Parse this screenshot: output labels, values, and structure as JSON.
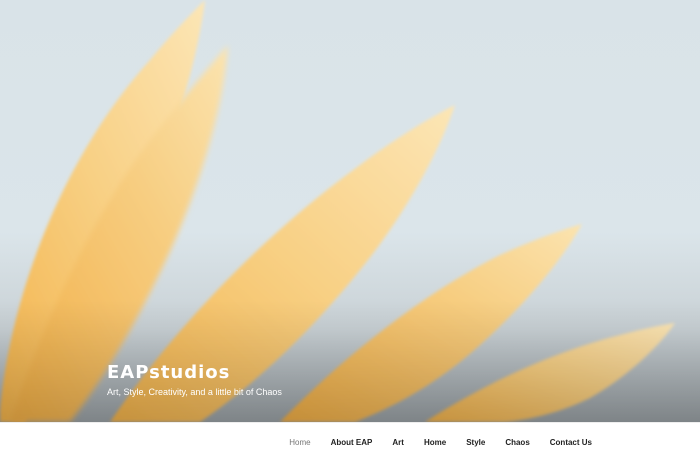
{
  "header": {
    "site_title": "EAPstudios",
    "site_description": "Art, Style, Creativity, and a little bit of Chaos",
    "image": "sunflower-petals-photo"
  },
  "menu": {
    "items": [
      {
        "label": "Home",
        "current": true
      },
      {
        "label": "About EAP"
      },
      {
        "label": "Art"
      },
      {
        "label": "Home"
      },
      {
        "label": "Style"
      },
      {
        "label": "Chaos"
      },
      {
        "label": "Contact Us"
      }
    ]
  },
  "colors": {
    "sky": "#d9e3e8",
    "petal": "#f6c873",
    "petal_light": "#fbe1a6",
    "title_text": "#ffffff"
  }
}
